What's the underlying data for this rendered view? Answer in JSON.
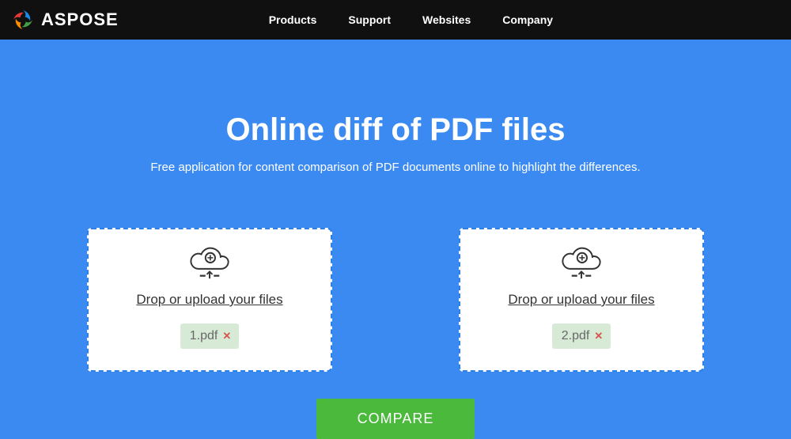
{
  "brand": {
    "name": "ASPOSE"
  },
  "nav": {
    "items": [
      "Products",
      "Support",
      "Websites",
      "Company"
    ]
  },
  "hero": {
    "title": "Online diff of PDF files",
    "subtitle": "Free application for content comparison of PDF documents online to highlight the differences."
  },
  "drop1": {
    "label": "Drop or upload your files",
    "file_name": "1.pdf"
  },
  "drop2": {
    "label": "Drop or upload your files",
    "file_name": "2.pdf"
  },
  "compare": {
    "label": "COMPARE"
  }
}
